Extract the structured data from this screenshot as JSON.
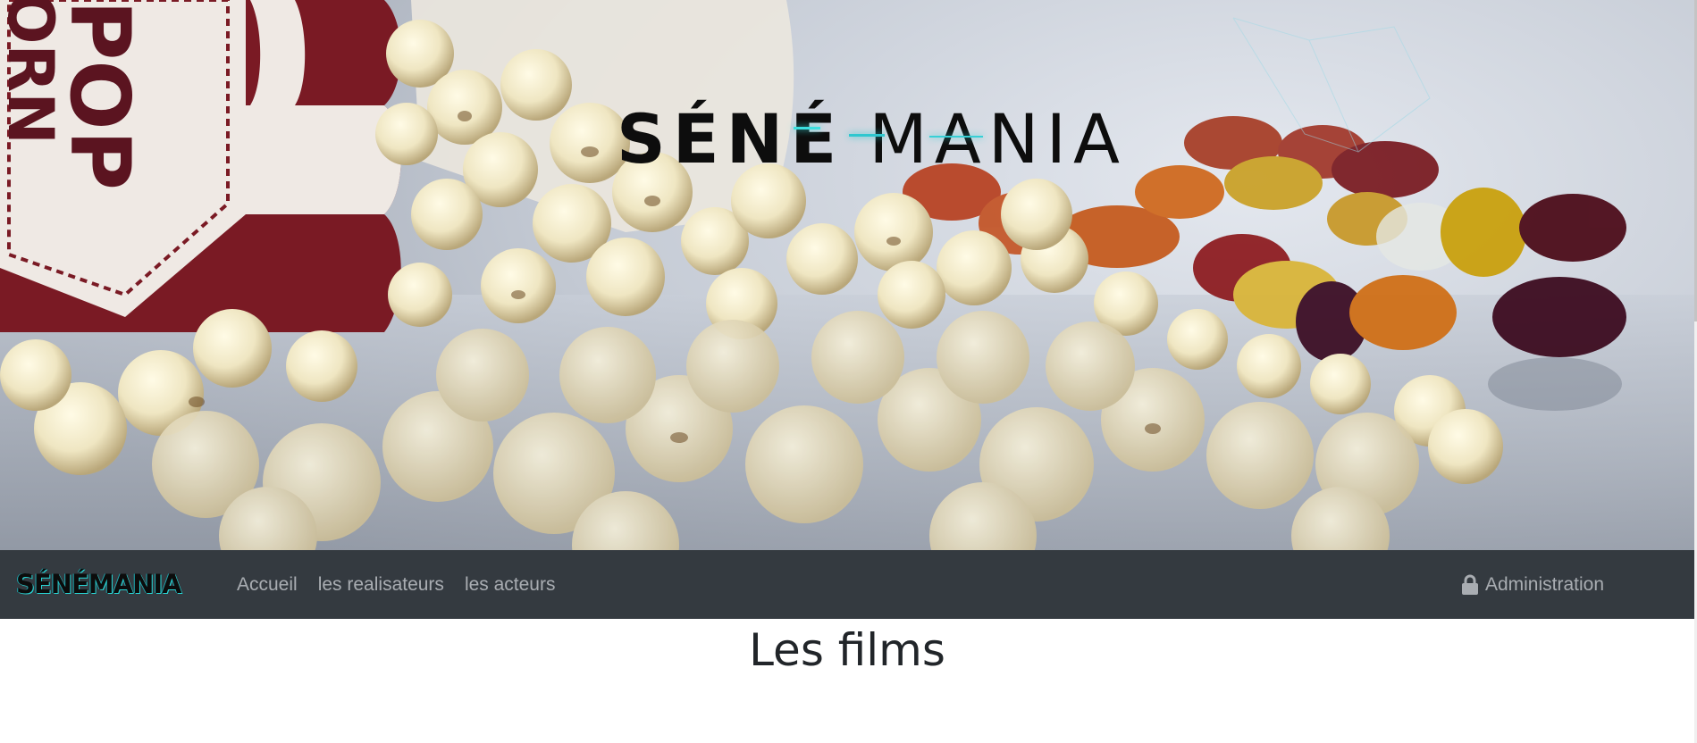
{
  "hero": {
    "title_part1": "SÉNÉ",
    "title_part2": "MANIA",
    "box_text": "POPCORN"
  },
  "navbar": {
    "brand": "SÉNÉMANIA",
    "links": [
      "Accueil",
      "les realisateurs",
      "les acteurs"
    ],
    "admin_label": "Administration",
    "admin_icon": "lock-icon"
  },
  "main": {
    "title": "Les films"
  },
  "colors": {
    "navbar_bg": "#343a40",
    "nav_link": "#a9adb2",
    "brand_accent": "#28d6d6",
    "popcorn_box_red": "#7a1a24"
  }
}
